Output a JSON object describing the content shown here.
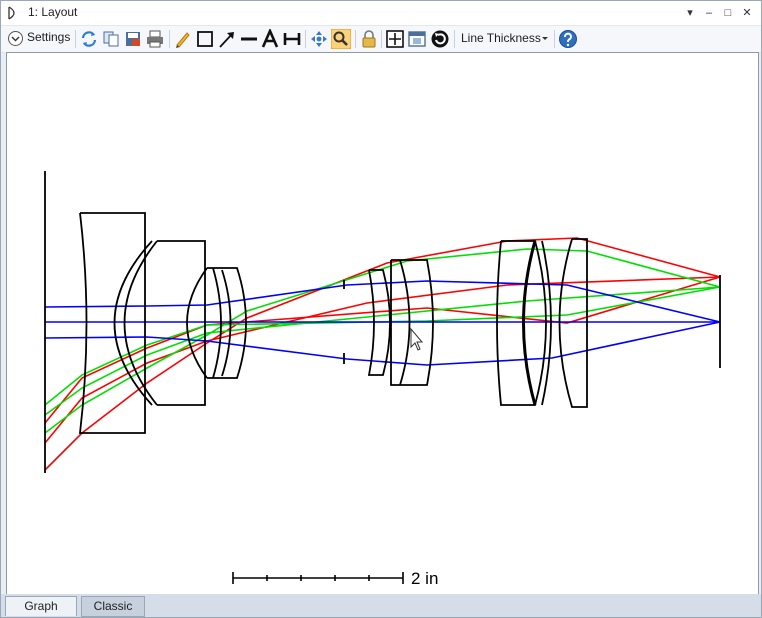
{
  "window": {
    "title": "1: Layout"
  },
  "title_buttons": {
    "dropdown": "▾",
    "minimize": "‒",
    "maximize": "□",
    "close": "✕"
  },
  "toolbar": {
    "settings_label": "Settings",
    "line_thickness_label": "Line Thickness"
  },
  "plot": {
    "scale_label": "2 in"
  },
  "tabs": [
    {
      "label": "Graph"
    },
    {
      "label": "Classic"
    }
  ],
  "colors": {
    "ray_red": "#ff0000",
    "ray_green": "#00e000",
    "ray_blue": "#0000ff",
    "lens": "#000000"
  },
  "icons": [
    "settings-chevron-icon",
    "refresh-icon",
    "copy-icon",
    "save-icon",
    "print-icon",
    "pencil-icon",
    "rectangle-icon",
    "arrow-icon",
    "line-icon",
    "text-icon",
    "dimension-icon",
    "pan-icon",
    "zoom-icon",
    "lock-icon",
    "fit-icon",
    "window-icon",
    "rotate-icon",
    "help-icon"
  ]
}
